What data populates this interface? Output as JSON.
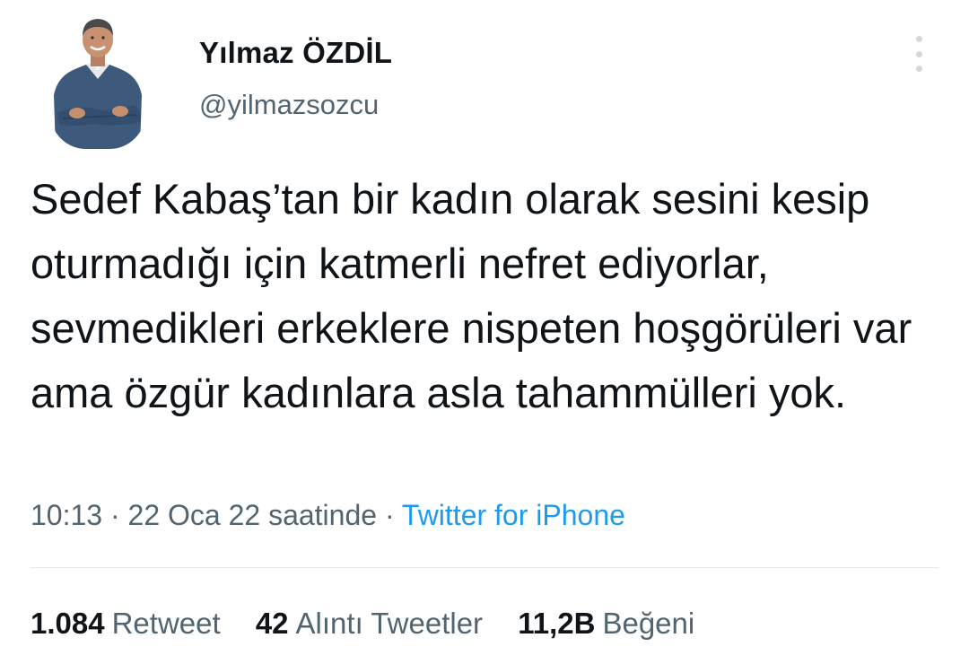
{
  "tweet": {
    "author": {
      "name": "Yılmaz ÖZDİL",
      "handle": "@yilmazsozcu"
    },
    "text": "Sedef Kabaş’tan bir kadın olarak sesini kesip oturmadığı için katmerli nefret ediyorlar, sevmedikleri erkeklere nispeten hoşgörüleri var ama özgür kadınlara asla tahammülleri yok.",
    "meta": {
      "time": "10:13",
      "sep1": " · ",
      "date": "22 Oca 22 saatinde",
      "sep2": " · ",
      "source": "Twitter for iPhone"
    },
    "stats": {
      "retweets": {
        "count": "1.084",
        "label": "Retweet"
      },
      "quotes": {
        "count": "42",
        "label": "Alıntı Tweetler"
      },
      "likes": {
        "count": "11,2B",
        "label": "Beğeni"
      }
    }
  },
  "icons": {
    "more": "more-vertical-icon",
    "avatar": "profile-photo"
  },
  "colors": {
    "text": "#0f1419",
    "secondary": "#536471",
    "link": "#1d9bf0",
    "divider": "#e6e9eb"
  }
}
